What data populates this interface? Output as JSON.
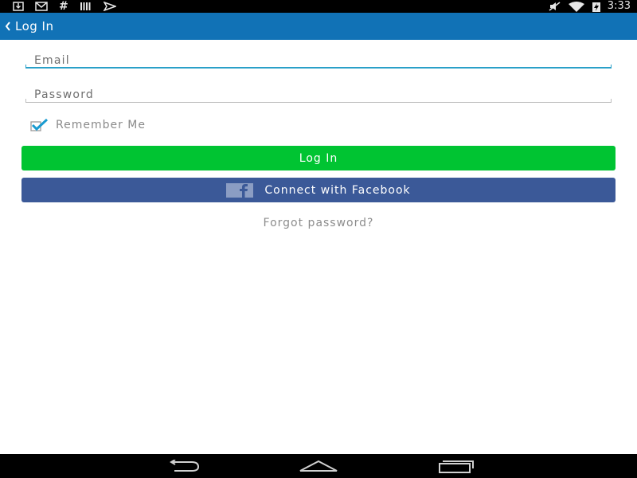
{
  "status_bar": {
    "time": "3:33",
    "left_icons": [
      "download-icon",
      "gmail-icon",
      "hash-icon",
      "barcode-icon",
      "play-store-icon"
    ],
    "right_icons": [
      "mute-icon",
      "wifi-icon",
      "battery-charging-icon"
    ]
  },
  "action_bar": {
    "title": "Log In",
    "color": "#1172b6"
  },
  "form": {
    "email_placeholder": "Email",
    "email_value": "",
    "password_placeholder": "Password",
    "password_value": "",
    "remember_label": "Remember Me",
    "remember_checked": true
  },
  "buttons": {
    "login_label": "Log In",
    "login_color": "#00c432",
    "facebook_label": "Connect with Facebook",
    "facebook_color": "#3b5998"
  },
  "forgot_link": "Forgot password?",
  "nav_bar": {
    "icons": [
      "nav-back-icon",
      "nav-home-icon",
      "nav-recents-icon"
    ]
  }
}
